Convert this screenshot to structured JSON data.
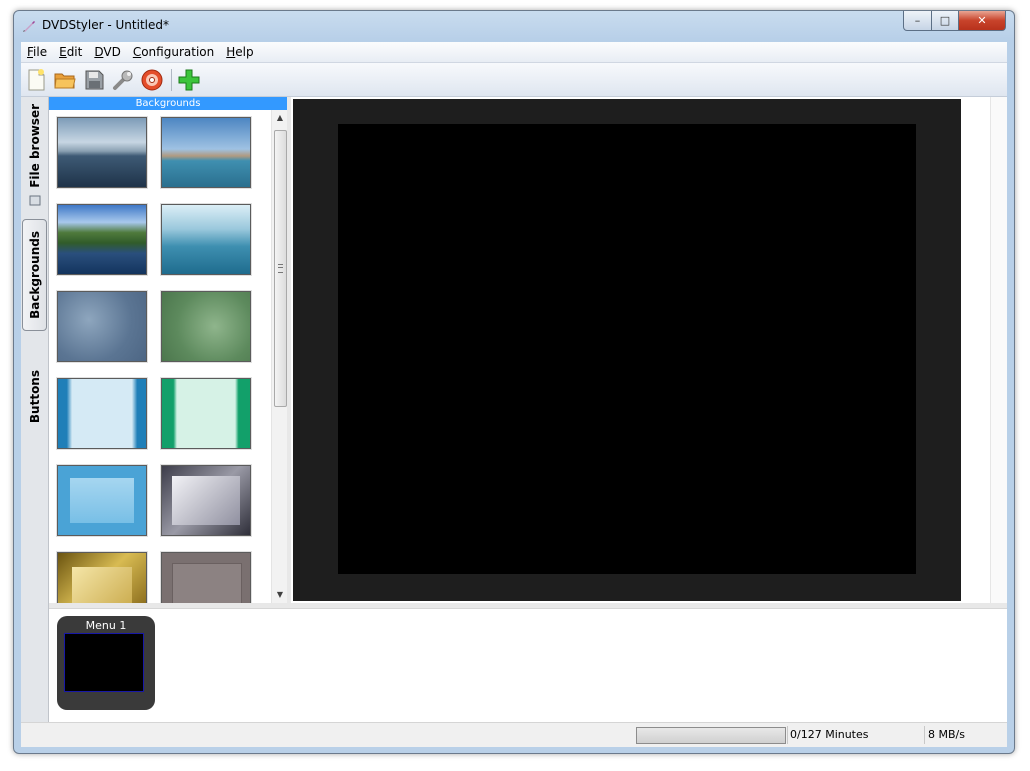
{
  "window": {
    "title": "DVDStyler - Untitled*",
    "controls": {
      "minimize": "–",
      "maximize": "□",
      "close": "✕"
    }
  },
  "menubar": {
    "items": [
      {
        "accel": "F",
        "rest": "ile"
      },
      {
        "accel": "E",
        "rest": "dit"
      },
      {
        "accel": "D",
        "rest": "VD"
      },
      {
        "accel": "C",
        "rest": "onfiguration"
      },
      {
        "accel": "H",
        "rest": "elp"
      }
    ]
  },
  "toolbar": {
    "icons": [
      "new-file-icon",
      "open-folder-icon",
      "save-icon",
      "settings-wrench-icon",
      "burn-disc-icon",
      "add-plus-icon"
    ]
  },
  "sidebar": {
    "tabs": [
      {
        "label": "File browser",
        "active": false
      },
      {
        "label": "Backgrounds",
        "active": true
      },
      {
        "label": "Buttons",
        "active": false
      }
    ]
  },
  "backgrounds_panel": {
    "header": "Backgrounds",
    "thumbnails": [
      "seascape-clouds",
      "ship-coast",
      "coastline-aerial",
      "blue-haze",
      "blue-gray-cloudy",
      "green-cloudy",
      "light-blue-banded",
      "mint-green-banded",
      "blue-frame",
      "gray-gradient-frame",
      "gold-frame",
      "stone-texture-frame"
    ]
  },
  "menus_strip": {
    "items": [
      {
        "label": "Menu 1"
      }
    ]
  },
  "statusbar": {
    "progress": 0,
    "duration": "0/127 Minutes",
    "rate": "8 MB/s"
  }
}
